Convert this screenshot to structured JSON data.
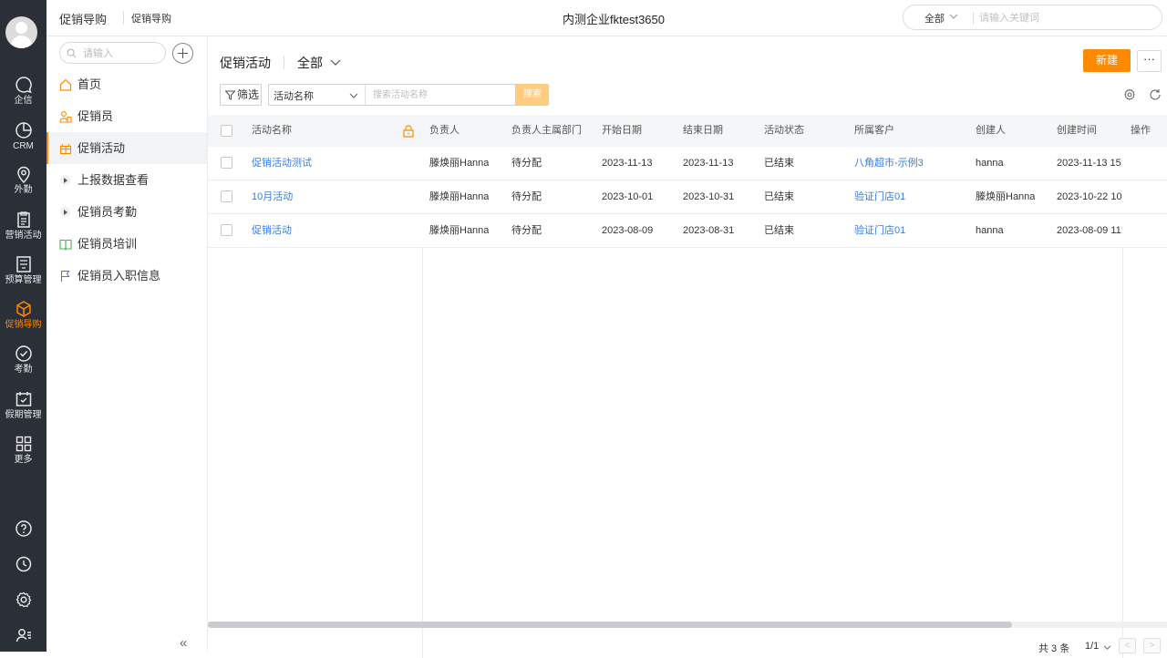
{
  "rail": {
    "items": [
      {
        "label": "企信",
        "icon": "chat-bubble-icon"
      },
      {
        "label": "CRM",
        "icon": "pie-chart-icon"
      },
      {
        "label": "外勤",
        "icon": "location-pin-icon"
      },
      {
        "label": "营销活动",
        "icon": "clipboard-icon"
      },
      {
        "label": "预算管理",
        "icon": "ledger-icon"
      },
      {
        "label": "促销导购",
        "icon": "box-icon",
        "active": true
      },
      {
        "label": "考勤",
        "icon": "check-circle-icon"
      },
      {
        "label": "假期管理",
        "icon": "calendar-check-icon"
      },
      {
        "label": "更多",
        "icon": "grid-icon"
      }
    ],
    "bottom_icons": [
      "help-icon",
      "clock-icon",
      "settings-icon",
      "user-list-icon"
    ],
    "active_color": "#ff8a00"
  },
  "topbar": {
    "app_title": "促销导购",
    "app_subtitle": "促销导购",
    "company": "内测企业fktest3650",
    "search_scope": "全部",
    "search_placeholder": "请输入关键词"
  },
  "sidenav": {
    "search_placeholder": "请输入",
    "items": [
      {
        "label": "首页"
      },
      {
        "label": "促销员"
      },
      {
        "label": "促销活动",
        "active": true
      },
      {
        "label": "上报数据查看"
      },
      {
        "label": "促销员考勤"
      },
      {
        "label": "促销员培训"
      },
      {
        "label": "促销员入职信息"
      }
    ],
    "collapse_label": "«"
  },
  "main": {
    "title": "促销活动",
    "scope": "全部",
    "new_label": "新建",
    "more_label": "···",
    "filter_label": "筛选",
    "filter_field": "活动名称",
    "filter_placeholder": "搜索活动名称",
    "search_label": "搜索"
  },
  "table": {
    "columns": [
      "活动名称",
      "负责人",
      "负责人主属部门",
      "开始日期",
      "结束日期",
      "活动状态",
      "所属客户",
      "创建人",
      "创建时间",
      "操作"
    ],
    "rows": [
      [
        "促销活动测试",
        "滕焕丽Hanna",
        "待分配",
        "2023-11-13",
        "2023-11-13",
        "已结束",
        "八角超市-示例3",
        "hanna",
        "2023-11-13 15:"
      ],
      [
        "10月活动",
        "滕焕丽Hanna",
        "待分配",
        "2023-10-01",
        "2023-10-31",
        "已结束",
        "验证门店01",
        "滕焕丽Hanna",
        "2023-10-22 10:"
      ],
      [
        "促销活动",
        "滕焕丽Hanna",
        "待分配",
        "2023-08-09",
        "2023-08-31",
        "已结束",
        "验证门店01",
        "hanna",
        "2023-08-09 11:"
      ]
    ],
    "link_color": "#3a7de0"
  },
  "pager": {
    "total": "共 3 条",
    "page": "1/1",
    "prev": "<",
    "next": ">"
  }
}
